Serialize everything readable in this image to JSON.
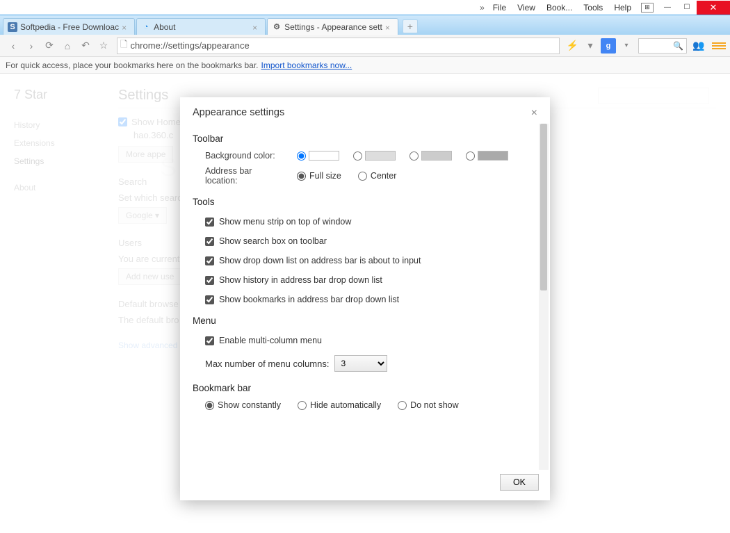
{
  "menubar": {
    "chevrons": "»",
    "items": [
      "File",
      "View",
      "Book...",
      "Tools",
      "Help"
    ]
  },
  "tabs": [
    {
      "title": "Softpedia - Free Downloac",
      "icon": "S"
    },
    {
      "title": "About",
      "icon": "b"
    },
    {
      "title": "Settings - Appearance sett",
      "icon": "⚙"
    }
  ],
  "address": "chrome://settings/appearance",
  "bookmark_hint": "For quick access, place your bookmarks here on the bookmarks bar.",
  "bookmark_link": "Import bookmarks now...",
  "side": {
    "brand": "7 Star",
    "items": [
      "History",
      "Extensions",
      "Settings",
      "",
      "About"
    ],
    "selected": 2
  },
  "page": {
    "title": "Settings",
    "show_home": "Show Home",
    "home_url": "hao.360.c",
    "more_apps": "More appe",
    "search_h": "Search",
    "search_txt": "Set which searc",
    "search_sel": "Google  ▾",
    "users_h": "Users",
    "users_txt": "You are current",
    "add_user": "Add new use",
    "def_h": "Default browse",
    "def_txt": "The default bro",
    "adv": "Show advanced se"
  },
  "modal": {
    "title": "Appearance settings",
    "toolbar_h": "Toolbar",
    "bgcolor_lbl": "Background color:",
    "addrloc_lbl": "Address bar location:",
    "addr_opts": [
      "Full size",
      "Center"
    ],
    "tools_h": "Tools",
    "tool_checks": [
      "Show menu strip on top of window",
      "Show search box on toolbar",
      "Show drop down list on address bar is about to input",
      "Show history in address bar drop down list",
      "Show bookmarks in address bar drop down list"
    ],
    "menu_h": "Menu",
    "menu_enable": "Enable multi-column menu",
    "menu_cols_lbl": "Max number of menu columns:",
    "menu_cols_val": "3",
    "bookmark_h": "Bookmark bar",
    "bookmark_opts": [
      "Show constantly",
      "Hide automatically",
      "Do not show"
    ],
    "ok": "OK"
  }
}
